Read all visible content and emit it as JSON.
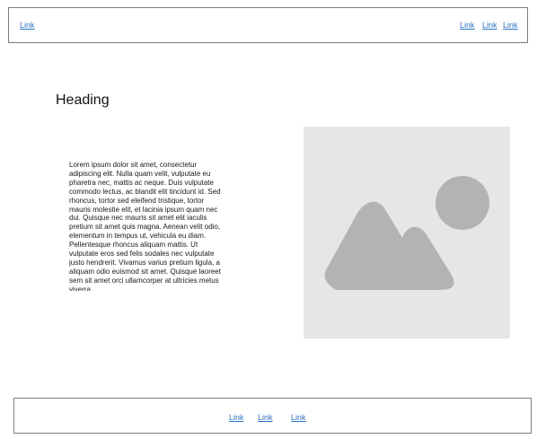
{
  "header": {
    "left_link": "Link",
    "right_links": [
      "Link",
      "Link",
      "Link"
    ]
  },
  "main": {
    "heading": "Heading",
    "paragraph": "Lorem ipsum dolor sit amet, consectetur adipiscing elit. Nulla quam velit, vulputate eu pharetra nec, mattis ac neque. Duis vulputate commodo lectus, ac blandit elit tincidunt id. Sed rhoncus, tortor sed eleifend tristique, tortor mauris molestie elit, et lacinia ipsum quam nec dui. Quisque nec mauris sit amet elit iaculis pretium sit amet quis magna. Aenean velit odio, elementum in tempus ut, vehicula eu diam. Pellentesque rhoncus aliquam mattis. Ut vulputate eros sed felis sodales nec vulputate justo hendrerit. Vivamus varius pretium ligula, a aliquam odio euismod sit amet. Quisque laoreet sem sit amet orci ullamcorper at ultricies metus viverra.",
    "image": {
      "icon": "image-placeholder-icon",
      "background_color": "#e6e6e6",
      "shape_color": "#b3b3b3"
    }
  },
  "footer": {
    "links": [
      "Link",
      "Link",
      "Link"
    ]
  },
  "colors": {
    "link": "#2d73c4",
    "border": "#7d7d7d"
  }
}
